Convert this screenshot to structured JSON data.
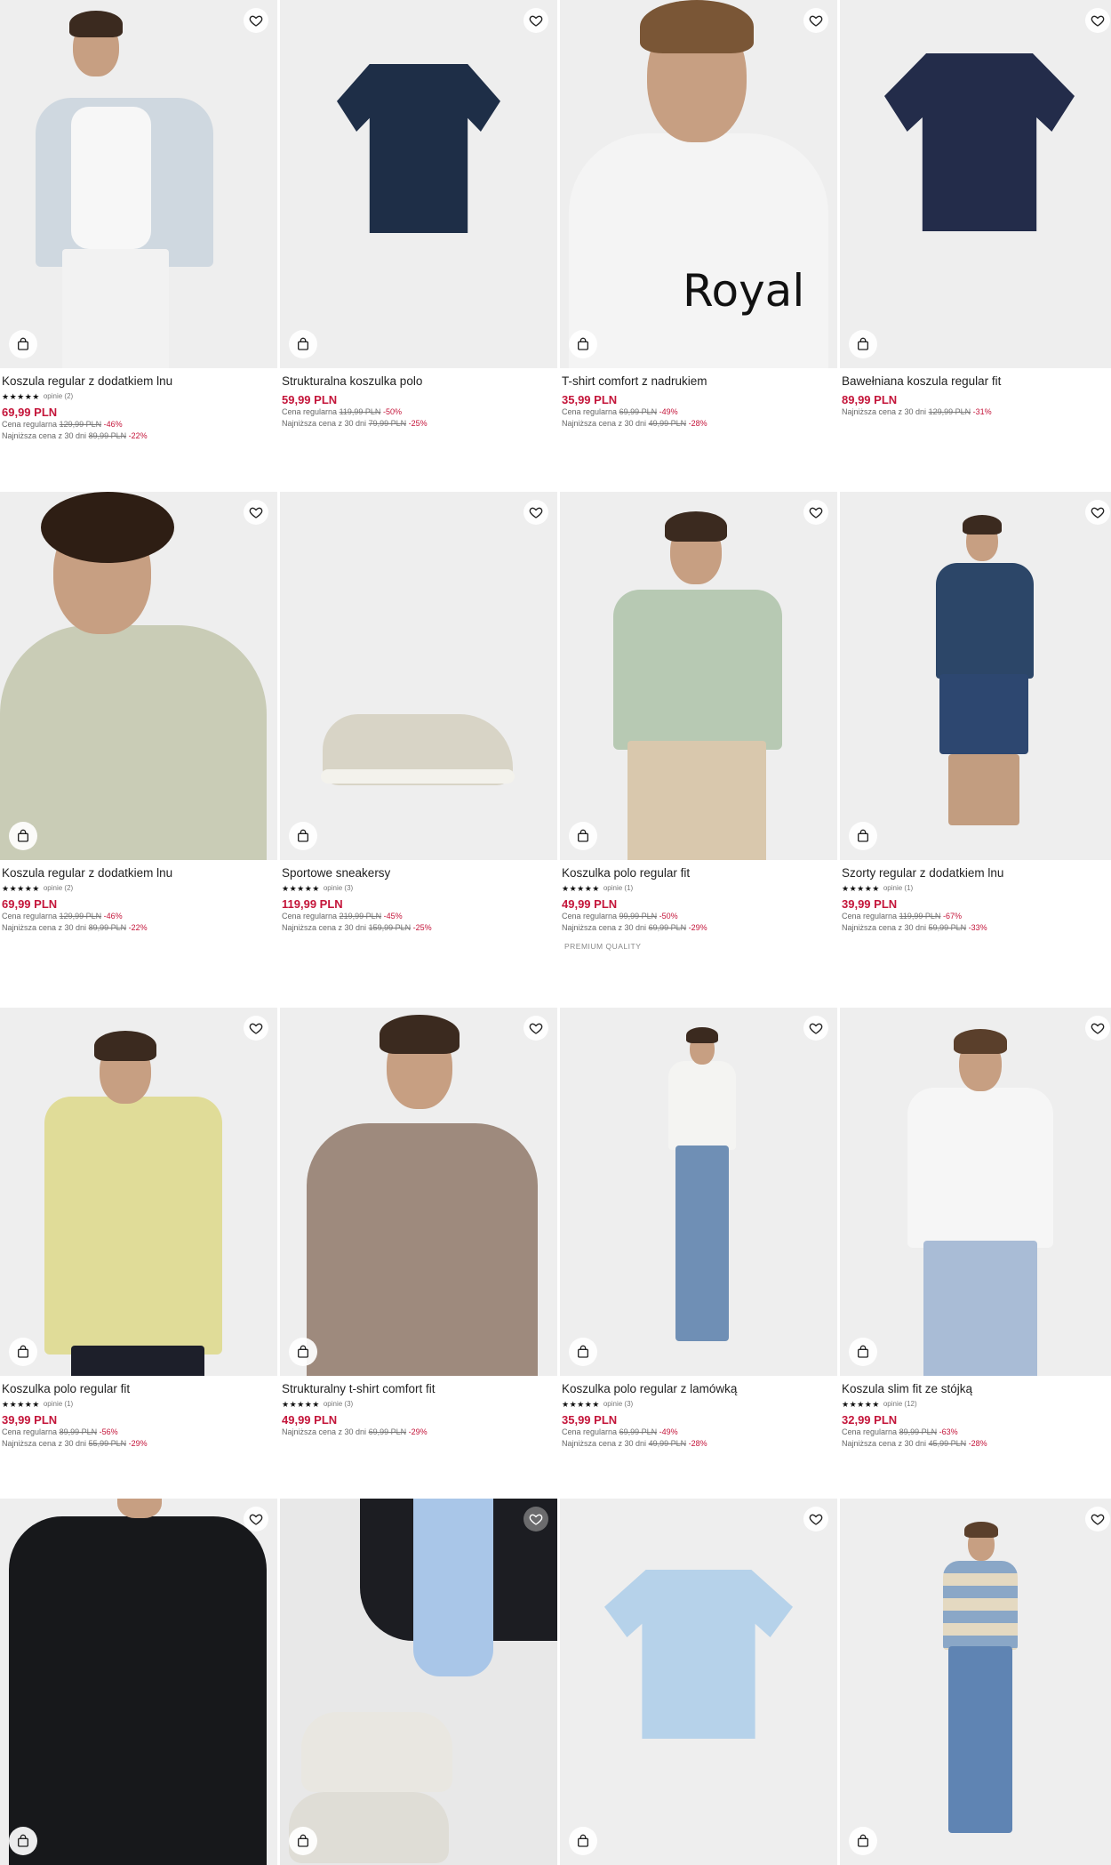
{
  "colors": {
    "accent_price": "#c4153a",
    "text": "#222222",
    "muted": "#666666"
  },
  "icons": {
    "favorite": "heart-icon",
    "bag": "shopping-bag-icon",
    "rating": "star-icon"
  },
  "products": [
    {
      "name": "Koszula regular z dodatkiem lnu",
      "stars": "★★★★★",
      "reviews": "opinie (2)",
      "price": "69,99 PLN",
      "regular_label": "Cena regularna",
      "regular_old": "129,99 PLN",
      "regular_pct": "-46%",
      "lowest_label": "Najniższa cena z 30 dni",
      "lowest_old": "89,99 PLN",
      "lowest_pct": "-22%"
    },
    {
      "name": "Strukturalna koszulka polo",
      "price": "59,99 PLN",
      "regular_label": "Cena regularna",
      "regular_old": "119,99 PLN",
      "regular_pct": "-50%",
      "lowest_label": "Najniższa cena z 30 dni",
      "lowest_old": "79,99 PLN",
      "lowest_pct": "-25%"
    },
    {
      "name": "T-shirt comfort z nadrukiem",
      "price": "35,99 PLN",
      "regular_label": "Cena regularna",
      "regular_old": "69,99 PLN",
      "regular_pct": "-49%",
      "lowest_label": "Najniższa cena z 30 dni",
      "lowest_old": "49,99 PLN",
      "lowest_pct": "-28%",
      "print_text": "Royal"
    },
    {
      "name": "Bawełniana koszula regular fit",
      "price": "89,99 PLN",
      "lowest_label": "Najniższa cena z 30 dni",
      "lowest_old": "129,99 PLN",
      "lowest_pct": "-31%"
    },
    {
      "name": "Koszula regular z dodatkiem lnu",
      "stars": "★★★★★",
      "reviews": "opinie (2)",
      "price": "69,99 PLN",
      "regular_label": "Cena regularna",
      "regular_old": "129,99 PLN",
      "regular_pct": "-46%",
      "lowest_label": "Najniższa cena z 30 dni",
      "lowest_old": "89,99 PLN",
      "lowest_pct": "-22%"
    },
    {
      "name": "Sportowe sneakersy",
      "stars": "★★★★★",
      "reviews": "opinie (3)",
      "price": "119,99 PLN",
      "regular_label": "Cena regularna",
      "regular_old": "219,99 PLN",
      "regular_pct": "-45%",
      "lowest_label": "Najniższa cena z 30 dni",
      "lowest_old": "159,99 PLN",
      "lowest_pct": "-25%"
    },
    {
      "name": "Koszulka polo regular fit",
      "stars": "★★★★★",
      "reviews": "opinie (1)",
      "price": "49,99 PLN",
      "regular_label": "Cena regularna",
      "regular_old": "99,99 PLN",
      "regular_pct": "-50%",
      "lowest_label": "Najniższa cena z 30 dni",
      "lowest_old": "69,99 PLN",
      "lowest_pct": "-29%",
      "badge": "PREMIUM QUALITY"
    },
    {
      "name": "Szorty regular z dodatkiem lnu",
      "stars": "★★★★★",
      "reviews": "opinie (1)",
      "price": "39,99 PLN",
      "regular_label": "Cena regularna",
      "regular_old": "119,99 PLN",
      "regular_pct": "-67%",
      "lowest_label": "Najniższa cena z 30 dni",
      "lowest_old": "59,99 PLN",
      "lowest_pct": "-33%"
    },
    {
      "name": "Koszulka polo regular fit",
      "stars": "★★★★★",
      "reviews": "opinie (1)",
      "price": "39,99 PLN",
      "regular_label": "Cena regularna",
      "regular_old": "89,99 PLN",
      "regular_pct": "-56%",
      "lowest_label": "Najniższa cena z 30 dni",
      "lowest_old": "55,99 PLN",
      "lowest_pct": "-29%"
    },
    {
      "name": "Strukturalny t-shirt comfort fit",
      "stars": "★★★★★",
      "reviews": "opinie (3)",
      "price": "49,99 PLN",
      "lowest_label": "Najniższa cena z 30 dni",
      "lowest_old": "69,99 PLN",
      "lowest_pct": "-29%"
    },
    {
      "name": "Koszulka polo regular z lamówką",
      "stars": "★★★★★",
      "reviews": "opinie (3)",
      "price": "35,99 PLN",
      "regular_label": "Cena regularna",
      "regular_old": "69,99 PLN",
      "regular_pct": "-49%",
      "lowest_label": "Najniższa cena z 30 dni",
      "lowest_old": "49,99 PLN",
      "lowest_pct": "-28%"
    },
    {
      "name": "Koszula slim fit ze stójką",
      "stars": "★★★★★",
      "reviews": "opinie (12)",
      "price": "32,99 PLN",
      "regular_label": "Cena regularna",
      "regular_old": "89,99 PLN",
      "regular_pct": "-63%",
      "lowest_label": "Najniższa cena z 30 dni",
      "lowest_old": "45,99 PLN",
      "lowest_pct": "-28%"
    },
    {
      "name": ""
    },
    {
      "name": ""
    },
    {
      "name": ""
    },
    {
      "name": ""
    }
  ]
}
